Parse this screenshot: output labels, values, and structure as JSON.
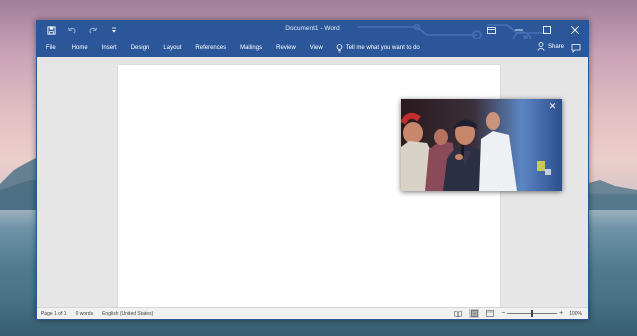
{
  "window": {
    "title": "Document1  -  Word"
  },
  "ribbon": {
    "tabs": [
      {
        "label": "File"
      },
      {
        "label": "Home"
      },
      {
        "label": "Insert"
      },
      {
        "label": "Design"
      },
      {
        "label": "Layout"
      },
      {
        "label": "References"
      },
      {
        "label": "Mailings"
      },
      {
        "label": "Review"
      },
      {
        "label": "View"
      }
    ],
    "tell_me": "Tell me what you want to do",
    "share": "Share"
  },
  "status": {
    "page": "Page 1 of 1",
    "words": "0 words",
    "language": "English (United States)",
    "zoom": "100%",
    "zoom_level": 1.0,
    "zoom_minus": "−",
    "zoom_plus": "+"
  },
  "pip": {
    "close_label": "✕"
  },
  "colors": {
    "accent": "#2b579a",
    "page": "#ffffff",
    "canvas": "#e6e6e6",
    "statusbar": "#f1f1f1"
  },
  "icons": [
    "save-icon",
    "undo-icon",
    "redo-icon",
    "customize-icon",
    "ribbon-display-icon",
    "minimize-icon",
    "maximize-icon",
    "close-icon",
    "lightbulb-icon",
    "person-icon",
    "comment-icon",
    "read-mode-icon",
    "print-layout-icon",
    "web-layout-icon"
  ]
}
